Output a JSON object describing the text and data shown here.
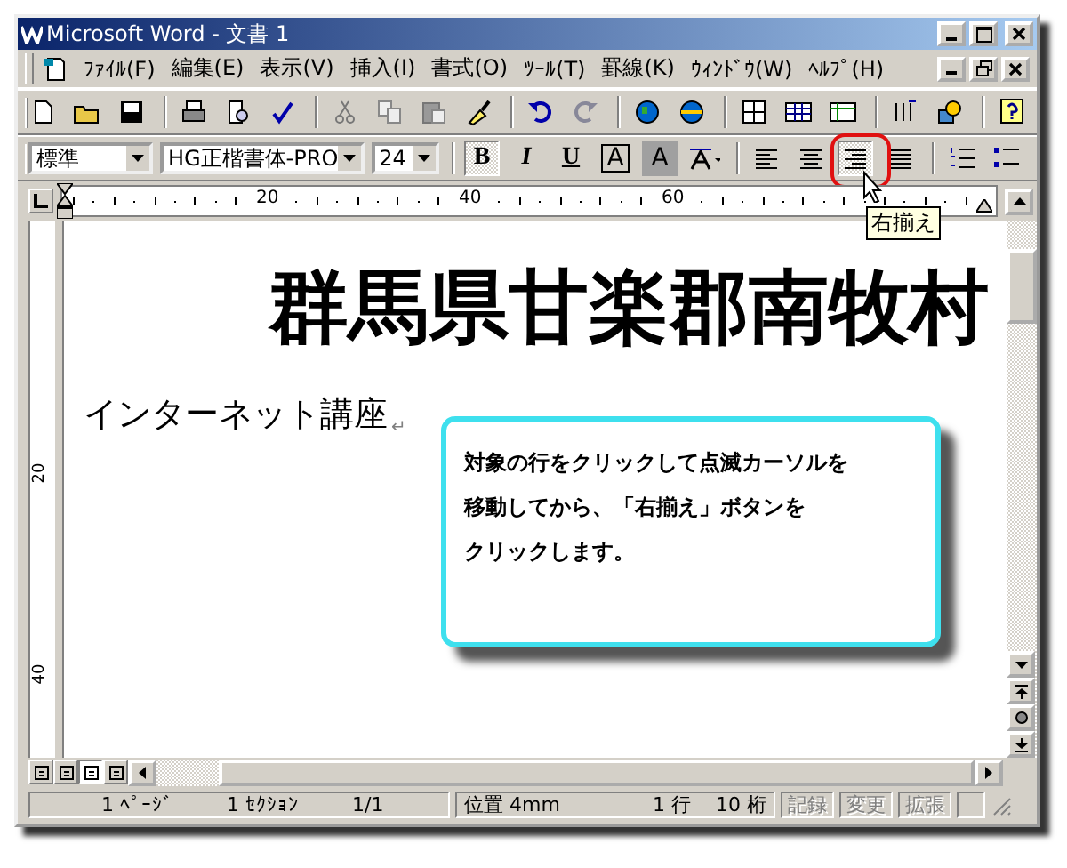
{
  "window": {
    "title": "Microsoft Word - 文書 1"
  },
  "menu": [
    "ﾌｧｲﾙ(F)",
    "編集(E)",
    "表示(V)",
    "挿入(I)",
    "書式(O)",
    "ﾂｰﾙ(T)",
    "罫線(K)",
    "ｳｨﾝﾄﾞｳ(W)",
    "ﾍﾙﾌﾟ(H)"
  ],
  "format_toolbar": {
    "style": "標準",
    "font": "HG正楷書体-PRO",
    "size": "24",
    "text_buttons": [
      {
        "label": "B",
        "kind": "bold",
        "pressed": true
      },
      {
        "label": "I",
        "kind": "italic",
        "pressed": false
      },
      {
        "label": "U",
        "kind": "underline",
        "pressed": false
      },
      {
        "label": "A",
        "kind": "boxed",
        "pressed": false
      },
      {
        "label": "A",
        "kind": "shaded",
        "pressed": false
      }
    ],
    "alignment_buttons": [
      {
        "kind": "left",
        "selected": false
      },
      {
        "kind": "center",
        "selected": false
      },
      {
        "kind": "right",
        "selected": true
      },
      {
        "kind": "justify",
        "selected": false
      }
    ],
    "tooltip": "右揃え"
  },
  "ruler": {
    "labels": [
      "20",
      "40",
      "60"
    ]
  },
  "vertical_ruler": {
    "labels": [
      "20",
      "40"
    ]
  },
  "document": {
    "heading": "群馬県甘楽郡南牧村",
    "line": "インターネット講座",
    "paragraph_mark": "↵"
  },
  "callout": {
    "lines": [
      "対象の行をクリックして点滅カーソルを",
      "移動してから、「右揃え」ボタンを",
      "クリックします。"
    ]
  },
  "view_buttons": [
    {
      "selected": false
    },
    {
      "selected": false
    },
    {
      "selected": true
    },
    {
      "selected": false
    }
  ],
  "status_bar": {
    "page": "1 ﾍﾟｰｼﾞ",
    "section": "1 ｾｸｼｮﾝ",
    "pages": "1/1",
    "position": "位置 4mm",
    "line": "1 行",
    "column": "10 桁",
    "modes": [
      {
        "label": "記録",
        "disabled": true
      },
      {
        "label": "変更",
        "disabled": true
      },
      {
        "label": "拡張",
        "disabled": true
      }
    ]
  }
}
